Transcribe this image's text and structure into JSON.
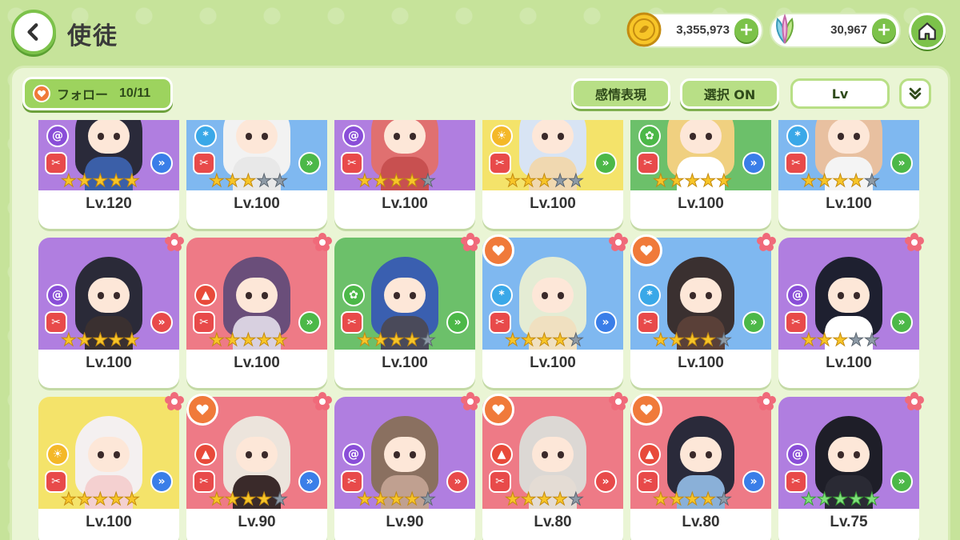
{
  "header": {
    "title": "使徒",
    "gold_amount": "3,355,973",
    "leaf_amount": "30,967",
    "plus_label": "+"
  },
  "toolbar": {
    "follow_label": "フォロー",
    "follow_count": "10/11",
    "emotion_label": "感情表現",
    "select_label": "選択 ON",
    "sort_label": "Lv"
  },
  "colors": {
    "accent": "#7cc24a",
    "background": "#c6e39a",
    "panel": "#eaf5d5"
  },
  "cards": [
    {
      "level": "Lv.120",
      "bg": "purple",
      "element": "vortex",
      "stars": [
        1,
        1,
        1,
        1,
        1
      ],
      "arrow": "blue",
      "fav": false,
      "flower": false,
      "hair": "#2a2a3a",
      "outfit": "#3b5fa8"
    },
    {
      "level": "Lv.100",
      "bg": "blue",
      "element": "ice",
      "stars": [
        1,
        1,
        1,
        0,
        0
      ],
      "arrow": "green",
      "fav": false,
      "flower": false,
      "hair": "#f2f2f2",
      "outfit": "#e8e8e8"
    },
    {
      "level": "Lv.100",
      "bg": "purple",
      "element": "vortex",
      "stars": [
        1,
        1,
        1,
        1,
        0
      ],
      "arrow": "none",
      "fav": false,
      "flower": false,
      "hair": "#e07070",
      "outfit": "#c85050"
    },
    {
      "level": "Lv.100",
      "bg": "yellow",
      "element": "light",
      "stars": [
        1,
        1,
        1,
        0,
        0
      ],
      "arrow": "green",
      "fav": false,
      "flower": false,
      "hair": "#d8e4f4",
      "outfit": "#f0d8b0"
    },
    {
      "level": "Lv.100",
      "bg": "green",
      "element": "leaf",
      "stars": [
        1,
        1,
        1,
        1,
        1
      ],
      "arrow": "blue",
      "fav": false,
      "flower": false,
      "hair": "#f0d080",
      "outfit": "#ffffff"
    },
    {
      "level": "Lv.100",
      "bg": "blue",
      "element": "ice",
      "stars": [
        1,
        1,
        1,
        1,
        0
      ],
      "arrow": "green",
      "fav": false,
      "flower": false,
      "hair": "#e8c0a0",
      "outfit": "#f4f4f4"
    },
    {
      "level": "Lv.100",
      "bg": "purple",
      "element": "vortex",
      "stars": [
        1,
        1,
        1,
        1,
        1
      ],
      "arrow": "red",
      "fav": false,
      "flower": true,
      "hair": "#2a2a38",
      "outfit": "#3a3030"
    },
    {
      "level": "Lv.100",
      "bg": "red",
      "element": "fire",
      "stars": [
        1,
        1,
        1,
        1,
        1
      ],
      "arrow": "green",
      "fav": false,
      "flower": true,
      "hair": "#6a4e7a",
      "outfit": "#d8d0e0"
    },
    {
      "level": "Lv.100",
      "bg": "green",
      "element": "leaf",
      "stars": [
        1,
        1,
        1,
        1,
        0
      ],
      "arrow": "green",
      "fav": false,
      "flower": true,
      "hair": "#3a5fb0",
      "outfit": "#4a4a5a"
    },
    {
      "level": "Lv.100",
      "bg": "blue",
      "element": "ice",
      "stars": [
        1,
        1,
        1,
        1,
        0
      ],
      "arrow": "blue",
      "fav": true,
      "flower": true,
      "hair": "#e4ecd4",
      "outfit": "#f0e0c0"
    },
    {
      "level": "Lv.100",
      "bg": "blue",
      "element": "ice",
      "stars": [
        1,
        1,
        1,
        1,
        0
      ],
      "arrow": "green",
      "fav": true,
      "flower": true,
      "hair": "#3a3030",
      "outfit": "#5a4038"
    },
    {
      "level": "Lv.100",
      "bg": "purple",
      "element": "vortex",
      "stars": [
        1,
        1,
        1,
        0,
        0
      ],
      "arrow": "green",
      "fav": false,
      "flower": true,
      "hair": "#1e2030",
      "outfit": "#ffffff"
    },
    {
      "level": "Lv.100",
      "bg": "yellow",
      "element": "light",
      "stars": [
        1,
        1,
        1,
        1,
        1
      ],
      "arrow": "blue",
      "fav": false,
      "flower": true,
      "hair": "#f4f0f0",
      "outfit": "#f4d0d0"
    },
    {
      "level": "Lv.90",
      "bg": "red",
      "element": "fire",
      "stars": [
        1,
        1,
        1,
        1,
        0
      ],
      "arrow": "blue",
      "fav": true,
      "flower": true,
      "hair": "#ece4dc",
      "outfit": "#3a2a2a"
    },
    {
      "level": "Lv.90",
      "bg": "purple",
      "element": "vortex",
      "stars": [
        1,
        1,
        1,
        1,
        0
      ],
      "arrow": "red",
      "fav": false,
      "flower": true,
      "hair": "#8a7060",
      "outfit": "#c0a090"
    },
    {
      "level": "Lv.80",
      "bg": "red",
      "element": "fire",
      "stars": [
        1,
        1,
        1,
        1,
        0
      ],
      "arrow": "red",
      "fav": true,
      "flower": true,
      "hair": "#dcd8d4",
      "outfit": "#e4dcd4"
    },
    {
      "level": "Lv.80",
      "bg": "red",
      "element": "fire",
      "stars": [
        1,
        1,
        1,
        1,
        0
      ],
      "arrow": "blue",
      "fav": true,
      "flower": true,
      "hair": "#2a2a3a",
      "outfit": "#8ab0d8"
    },
    {
      "level": "Lv.75",
      "bg": "purple",
      "element": "vortex",
      "stars": [
        2,
        2,
        2,
        2,
        2
      ],
      "arrow": "green",
      "fav": false,
      "flower": true,
      "hair": "#1e1e28",
      "outfit": "#2a2a34"
    }
  ]
}
